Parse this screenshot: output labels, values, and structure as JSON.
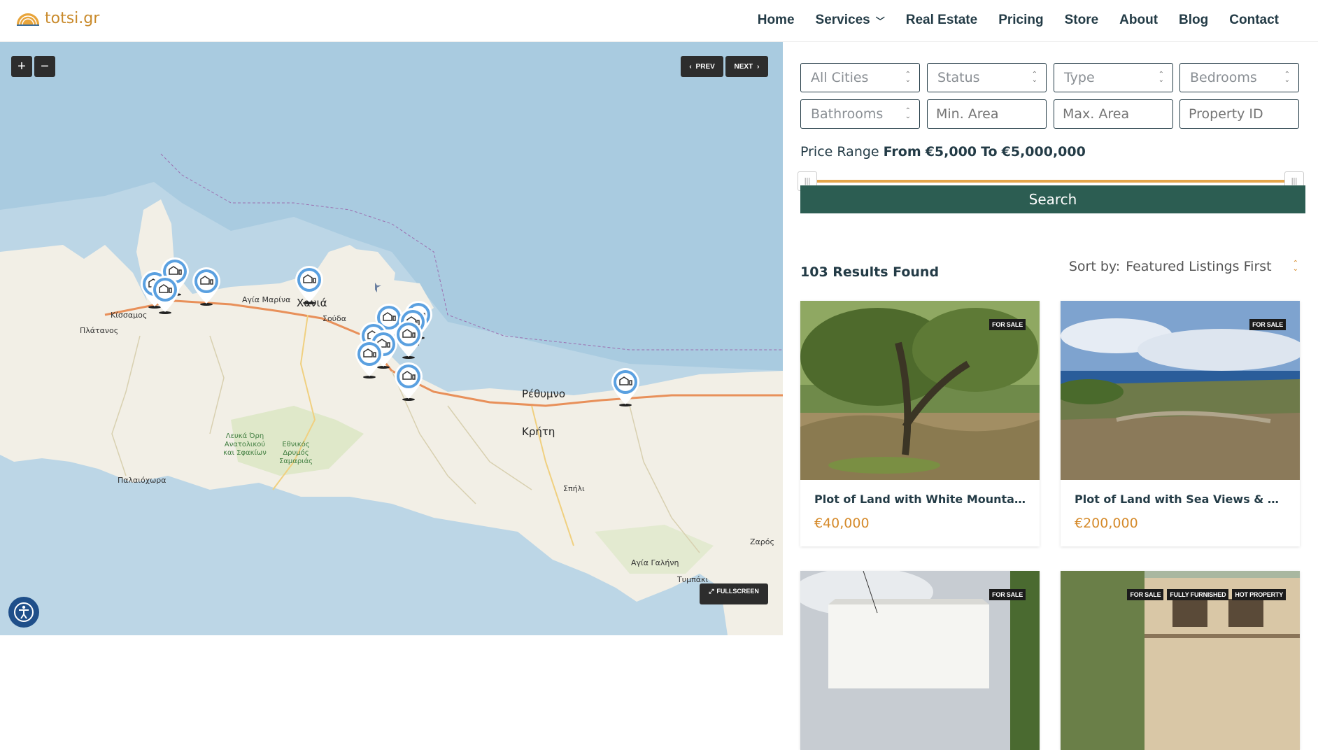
{
  "header": {
    "logo_text": "totsi.gr",
    "nav": [
      {
        "label": "Home"
      },
      {
        "label": "Services",
        "has_dropdown": true
      },
      {
        "label": "Real Estate"
      },
      {
        "label": "Pricing"
      },
      {
        "label": "Store"
      },
      {
        "label": "About"
      },
      {
        "label": "Blog"
      },
      {
        "label": "Contact"
      }
    ]
  },
  "map": {
    "zoom_in": "+",
    "zoom_out": "−",
    "prev_label": "PREV",
    "next_label": "NEXT",
    "fullscreen_label": "FULLSCREEN",
    "labels": {
      "kissamos": "Κίσσαμος",
      "platanos": "Πλάτανος",
      "agia_marina": "Αγία Μαρίνα",
      "chania": "Χανιά",
      "souda": "Σούδα",
      "rethymno": "Ρέθυμνο",
      "kriti": "Κρήτη",
      "park": "Λευκά Όρη Ανατολικού και Σφακίων",
      "national_park": "Εθνικός Δρυμός Σαμαριάς",
      "paleochora": "Παλαιόχωρα",
      "spili": "Σπήλι",
      "zaros": "Ζαρός",
      "agia_galini": "Αγία Γαλήνη",
      "tympaki": "Τυμπάκι"
    },
    "colors": {
      "sea": "#a9cbe0",
      "land": "#f2efe6",
      "marker": "#4a90d9"
    }
  },
  "filters": {
    "cities": "All Cities",
    "status": "Status",
    "type": "Type",
    "bedrooms": "Bedrooms",
    "bathrooms": "Bathrooms",
    "min_area_placeholder": "Min. Area",
    "max_area_placeholder": "Max. Area",
    "property_id_placeholder": "Property ID"
  },
  "price": {
    "label": "Price Range",
    "from_label": "From",
    "from_value": "€5,000",
    "to_label": "To",
    "to_value": "€5,000,000"
  },
  "search_label": "Search",
  "results_text": "103 Results Found",
  "sort": {
    "label": "Sort by:",
    "value": "Featured Listings First"
  },
  "listings": [
    {
      "title": "Plot of Land with White Mountain Views",
      "price": "€40,000",
      "badges": [
        "FOR SALE"
      ]
    },
    {
      "title": "Plot of Land with Sea Views & Building Permit",
      "price": "€200,000",
      "badges": [
        "FOR SALE"
      ]
    },
    {
      "title": "",
      "price": "",
      "badges": [
        "FOR SALE"
      ]
    },
    {
      "title": "",
      "price": "",
      "badges": [
        "FOR SALE",
        "FULLY FURNISHED",
        "HOT PROPERTY"
      ]
    }
  ],
  "accent_colors": {
    "brand_dark": "#233b46",
    "search_button": "#2c5d52",
    "price": "#d58a2a",
    "slider": "#e4a64b"
  }
}
